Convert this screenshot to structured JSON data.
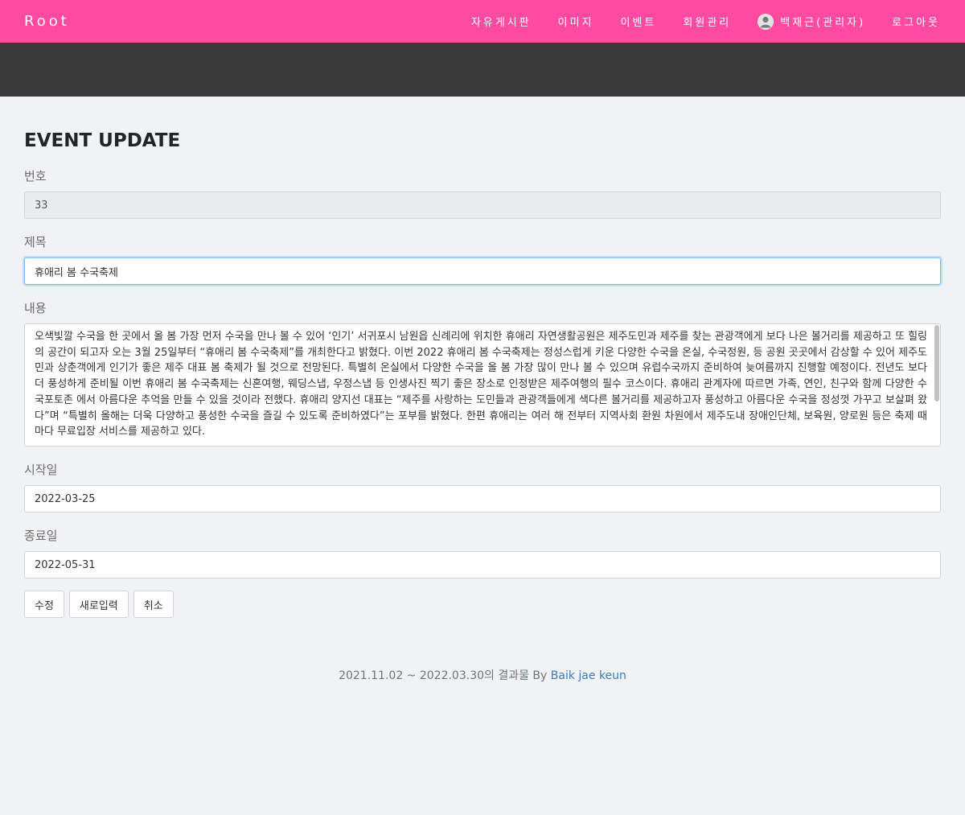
{
  "navbar": {
    "brand": "Root",
    "items": [
      {
        "label": "자유게시판"
      },
      {
        "label": "이미지"
      },
      {
        "label": "이벤트"
      },
      {
        "label": "회원관리"
      }
    ],
    "user": "백재근(관리자)",
    "logout": "로그아웃",
    "colors": {
      "navbar": "#ff4aa2",
      "band": "#3a3a3a"
    }
  },
  "form": {
    "title": "EVENT UPDATE",
    "number_label": "번호",
    "number_value": "33",
    "subject_label": "제목",
    "subject_value": "휴애리 봄 수국축제",
    "content_label": "내용",
    "content_value": "오색빛깔 수국을 한 곳에서 올 봄 가장 먼저 수국을 만나 볼 수 있어 ‘인기’ 서귀포시 남원읍 신례리에 위치한 휴애리 자연생활공원은 제주도민과 제주를 찾는 관광객에게 보다 나은 볼거리를 제공하고 또 힐링의 공간이 되고자 오는 3월 25일부터 “휴애리 봄 수국축제”를 개최한다고 밝혔다. 이번 2022 휴애리 봄 수국축제는 정성스럽게 키운 다양한 수국을 온실, 수국정원, 등 공원 곳곳에서 감상할 수 있어 제주도민과 상춘객에게 인기가 좋은 제주 대표 봄 축제가 될 것으로 전망된다. 특별히 온실에서 다양한 수국을 올 봄 가장 많이 만나 볼 수 있으며 유럽수국까지 준비하여 늦여름까지 진행할 예정이다. 전년도 보다 더 풍성하게 준비될 이번 휴애리 봄 수국축제는 신혼여행, 웨딩스냅, 우정스냅 등 인생사진 찍기 좋은 장소로 인정받은 제주여행의 필수 코스이다. 휴애리 관계자에 따르면 가족, 연인, 친구와 함께 다양한 수국포토존 에서 아름다운 추억을 만들 수 있을 것이라 전했다. 휴애리 양지선 대표는 “제주를 사랑하는 도민들과 관광객들에게 색다른 볼거리를 제공하고자 풍성하고 아름다운 수국을 정성껏 가꾸고 보살펴 왔다”며 “특별히 올해는 더욱 다양하고 풍성한 수국을 즐길 수 있도록 준비하였다”는 포부를 밝혔다. 한편 휴애리는 여러 해 전부터 지역사회 환원 차원에서 제주도내 장애인단체, 보육원, 양로원 등은 축제 때마다 무료입장 서비스를 제공하고 있다.",
    "start_label": "시작일",
    "start_value": "2022-03-25",
    "end_label": "종료일",
    "end_value": "2022-05-31",
    "buttons": {
      "update": "수정",
      "reset": "새로입력",
      "cancel": "취소"
    }
  },
  "footer": {
    "text": "2021.11.02 ~ 2022.03.30의 결과물 By ",
    "author": "Baik jae keun"
  }
}
